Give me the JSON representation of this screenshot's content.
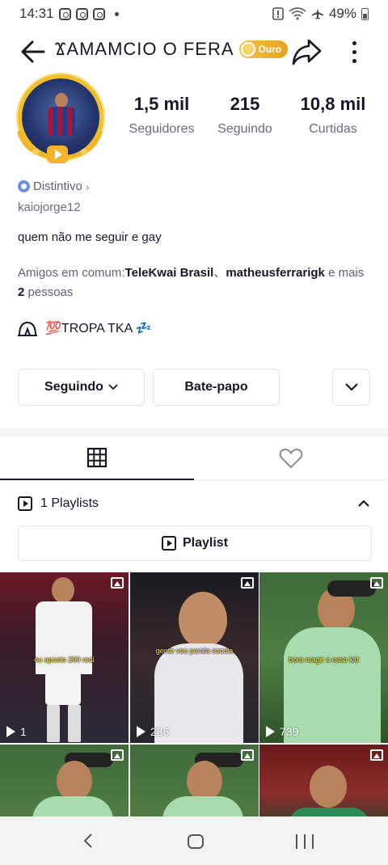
{
  "status_bar": {
    "time": "14:31",
    "battery": "49%"
  },
  "header": {
    "title": "ϪAMAMCIO O FERA",
    "badge": "Ouro"
  },
  "stats": [
    {
      "value": "1,5 mil",
      "label": "Seguidores"
    },
    {
      "value": "215",
      "label": "Seguindo"
    },
    {
      "value": "10,8 mil",
      "label": "Curtidas"
    }
  ],
  "profile": {
    "distintivo": "Distintivo",
    "username": "kaiojorge12",
    "bio": "quem não me seguir e gay",
    "mutual_prefix": "Amigos em comum:",
    "mutual_friend1": "TeleKwai Brasil",
    "mutual_sep": "、",
    "mutual_friend2": "matheusferrarigk",
    "mutual_mid": " e mais ",
    "mutual_count": "2",
    "mutual_suffix": " pessoas",
    "group": "💯TROPA TKA 💤"
  },
  "buttons": {
    "following": "Seguindo",
    "chat": "Bate-papo"
  },
  "playlists": {
    "summary": "1 Playlists",
    "button": "Playlist"
  },
  "videos": [
    {
      "caption": "eu aposto 200 real",
      "views": "1"
    },
    {
      "caption": "gente vou parala escola",
      "views": "286"
    },
    {
      "caption": "bora reagir a esse kid",
      "views": "739"
    },
    {
      "caption": "",
      "views": ""
    },
    {
      "caption": "",
      "views": ""
    },
    {
      "caption": "",
      "views": ""
    }
  ],
  "colors": {
    "gold": "#f0bf2c",
    "text": "#161823",
    "muted": "#6b6e78"
  }
}
